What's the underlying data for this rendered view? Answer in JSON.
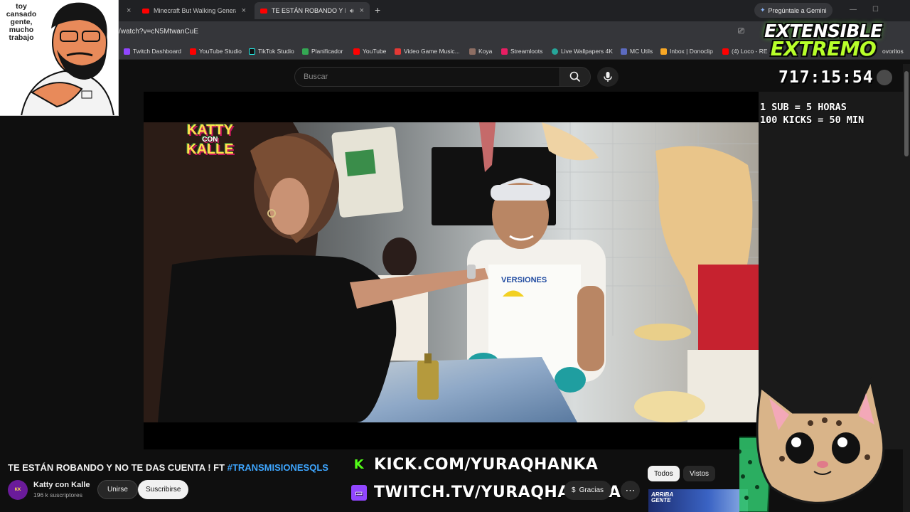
{
  "browser": {
    "tabs": [
      {
        "label": "Minecraft But Walking Generat"
      },
      {
        "label": "TE ESTÁN ROBANDO Y NO"
      }
    ],
    "gemini_label": "Pregúntale a Gemini",
    "url": "/watch?v=cN5MtwanCuE",
    "bookmarks": [
      {
        "label": "Twitch Dashboard",
        "color": "#9146ff"
      },
      {
        "label": "YouTube Studio",
        "color": "#ff0000"
      },
      {
        "label": "TikTok Studio",
        "color": "#111111"
      },
      {
        "label": "Planificador",
        "color": "#34a853"
      },
      {
        "label": "YouTube",
        "color": "#ff0000"
      },
      {
        "label": "Video Game Music...",
        "color": "#e53935"
      },
      {
        "label": "Koya",
        "color": "#8d6e63"
      },
      {
        "label": "Streamloots",
        "color": "#e91e63"
      },
      {
        "label": "Live Wallpapers 4K",
        "color": "#26a69a"
      },
      {
        "label": "MC Utils",
        "color": "#5c6bc0"
      },
      {
        "label": "Inbox | Donoclip",
        "color": "#f9a825"
      },
      {
        "label": "(4) Loco - RE",
        "color": "#ff0000"
      }
    ],
    "bookmarks_overflow": "ovoritos"
  },
  "youtube": {
    "search_placeholder": "Buscar",
    "video_title_main": "TE ESTÁN ROBANDO Y NO TE DAS CUENTA ! FT ",
    "video_title_tag": "#TRANSMISIONESQLS",
    "channel_name": "Katty con Kalle",
    "channel_subs": "196 k suscriptores",
    "join_label": "Unirse",
    "subscribe_label": "Suscribirse",
    "thanks_label": "Gracias",
    "chips": [
      "Todos",
      "Vistos"
    ],
    "related_thumb_text": "ARRIBA\nGENTE"
  },
  "video_overlay": {
    "channel_logo_top": "KATTY",
    "channel_logo_mid": "CON",
    "channel_logo_bottom": "KALLE",
    "apron_text": "VERSIONES"
  },
  "stream_overlay": {
    "webcam_caption": "toy cansado gente, mucho trabajo",
    "logo_line1": "EXTENSIBLE",
    "logo_line2": "EXTREMO",
    "timer": "717:15:54",
    "rule1": "1 SUB = 5 HORAS",
    "rule2": "100 KICKS = 50 MIN",
    "kick_url": "KICK.COM/YURAQHANKA",
    "twitch_url": "TWITCH.TV/YURAQHANKAA"
  },
  "colors": {
    "yt_bg": "#0f0f0f",
    "hashtag": "#3ea6ff",
    "kick_green": "#53fc18",
    "twitch_purple": "#9146ff",
    "logo_green": "#b8ff2a"
  }
}
